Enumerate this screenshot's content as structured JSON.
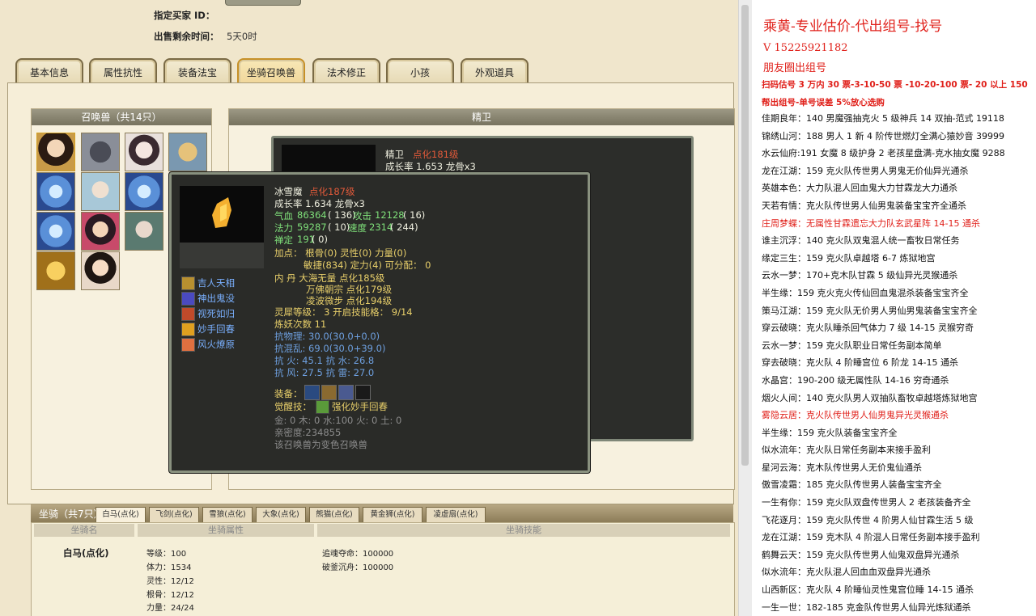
{
  "info": {
    "buyer_label": "指定买家 ID：",
    "buyer_value": "",
    "remain_label": "出售剩余时间：",
    "remain_value": "5天0时"
  },
  "tabs": [
    "基本信息",
    "属性抗性",
    "装备法宝",
    "坐骑召唤兽",
    "法术修正",
    "小孩",
    "外观道具"
  ],
  "active_tab": "坐骑召唤兽",
  "pet_panel": {
    "title": "召唤兽（共14只）",
    "count": 14
  },
  "jingwei_panel": {
    "title": "精卫",
    "name": "精卫",
    "tag": "点化181级",
    "growth": "成长率 1.653 龙骨x3"
  },
  "tooltip": {
    "name": "冰雪魔",
    "tag": "点化187级",
    "growth": "成长率 1.634 龙骨x3",
    "hp_label": "气血",
    "hp": "86364",
    "hp_pt": "( 136)",
    "atk_label": "攻击",
    "atk": "12128",
    "atk_pt": "( 16)",
    "mp_label": "法力",
    "mp": "59287",
    "mp_pt": "( 10)",
    "spd_label": "速度",
    "spd": "2314",
    "spd_pt": "( 244)",
    "cz_label": "禅定",
    "cz": "191",
    "cz_pt": "( 0)",
    "add1": "加点：  根骨(0) 灵性(0) 力量(0)",
    "add2": "敏捷(834) 定力(4) 可分配： 0",
    "neidan1": "内    丹  大海无量 点化185级",
    "neidan2": "万佛朝宗 点化179级",
    "neidan3": "凌波微步 点化194级",
    "lx": "灵犀等级： 3 开启技能格： 9/14",
    "lyao": "炼妖次数 11",
    "kwl": "抗物理: 30.0(30.0+0.0)",
    "khl": "抗混乱: 69.0(30.0+39.0)",
    "kh": "抗    火: 45.1 抗    水: 26.8",
    "kf": "抗    风: 27.5 抗    雷: 27.0",
    "equip": "装备：",
    "jx_label": "觉醒技：",
    "jx": "强化妙手回春",
    "wuxing": "金: 0 木: 0 水:100 火: 0 土: 0",
    "qmd": "亲密度:234855",
    "bianshen": "该召唤兽为变色召唤兽",
    "skills": [
      "吉人天相",
      "神出鬼没",
      "视死如归",
      "妙手回春",
      "风火燎原"
    ]
  },
  "mount": {
    "title": "坐骑（共7只）",
    "tabs": [
      "白马(点化)",
      "飞剑(点化)",
      "雪狼(点化)",
      "大象(点化)",
      "熊猫(点化)",
      "黄金狮(点化)",
      "凌虚扇(点化)"
    ],
    "col_name": "坐骑名",
    "col_attr": "坐骑属性",
    "col_skill": "坐骑技能",
    "name": "白马(点化)",
    "attrs": [
      "等级：100",
      "体力：1534",
      "灵性：12/12",
      "根骨：12/12",
      "力量：24/24"
    ],
    "skills": [
      "追魂夺命：100000",
      "破釜沉舟：100000"
    ]
  },
  "ad": {
    "title": "乘黄-专业估价-代出组号-找号",
    "phone": "V 15225921182",
    "line2": "朋友圈出组号",
    "line3": "扫码估号 3 万内 30 票-3-10-50 票  -10-20-100 票- 20 以上 150",
    "line4": "帮出组号-单号误差 5%放心选购"
  },
  "ad_list": [
    {
      "text": "佳期良年：140 男魔强抽克火 5 级神兵 14 双抽-范式 19118",
      "red": false
    },
    {
      "text": "锦绣山河：188 男人 1 新 4 阶传世燃灯全满心猿妙音 39999",
      "red": false
    },
    {
      "text": "水云仙府:191 女魔 8 级护身 2 老孩星盘满-克水抽女魔 9288",
      "red": false
    },
    {
      "text": "龙在江湖：159 克火队传世男人男鬼无价仙异光通杀",
      "red": false
    },
    {
      "text": "英雄本色：大力队混人回血鬼大力甘霖龙大力通杀",
      "red": false
    },
    {
      "text": "天若有情：克火队传世男人仙男鬼装备宝宝齐全通杀",
      "red": false
    },
    {
      "text": "庄周梦蝶：无属性甘霖遗忘大力队玄武星阵 14-15 通杀",
      "red": true
    },
    {
      "text": "谁主沉浮：140 克火队双鬼混人统一畜牧日常任务",
      "red": false
    },
    {
      "text": "缘定三生：159 克火队卓越塔 6-7 炼狱地宫",
      "red": false
    },
    {
      "text": "云水一梦：170+克木队甘霖 5 级仙异光灵猴通杀",
      "red": false
    },
    {
      "text": "半生缘：159 克火克火传仙回血鬼混杀装备宝宝齐全",
      "red": false
    },
    {
      "text": "策马江湖：159 克火队无价男人男仙男鬼装备宝宝齐全",
      "red": false
    },
    {
      "text": "穿云破晓：克火队睡杀回气体力 7 级 14-15 灵猴穷奇",
      "red": false
    },
    {
      "text": "云水一梦：159 克火队职业日常任务副本简单",
      "red": false
    },
    {
      "text": "穿去破晓：克火队 4 阶睡宫位 6 阶龙 14-15 通杀",
      "red": false
    },
    {
      "text": "水晶宫：190-200 级无属性队 14-16 穷奇通杀",
      "red": false
    },
    {
      "text": "烟火人间：140 克火队男人双抽队畜牧卓越塔炼狱地宫",
      "red": false
    },
    {
      "text": "雾隐云居：克火队传世男人仙男鬼异光灵猴通杀",
      "red": true
    },
    {
      "text": "半生缘：159 克火队装备宝宝齐全",
      "red": false
    },
    {
      "text": "似水流年：克火队日常任务副本来接手盈利",
      "red": false
    },
    {
      "text": "星河云海：克木队传世男人无价鬼仙通杀",
      "red": false
    },
    {
      "text": "傲雪凌霜：185 克火队传世男人装备宝宝齐全",
      "red": false
    },
    {
      "text": "一生有你：159 克火队双盘传世男人 2 老孩装备齐全",
      "red": false
    },
    {
      "text": "飞花逐月：159 克火队传世 4 阶男人仙甘霖生活 5 级",
      "red": false
    },
    {
      "text": "龙在江湖：159 克木队 4 阶混人日常任务副本接手盈利",
      "red": false
    },
    {
      "text": "鹤舞云天：159 克火队传世男人仙鬼双盘异光通杀",
      "red": false
    },
    {
      "text": "似水流年：克火队混人回血血双盘异光通杀",
      "red": false
    },
    {
      "text": "山西新区：克火队 4 阶睡仙灵性鬼宫位睡 14-15 通杀",
      "red": false
    },
    {
      "text": "一生一世：182-185 克金队传世男人仙异光炼狱通杀",
      "red": false
    }
  ]
}
